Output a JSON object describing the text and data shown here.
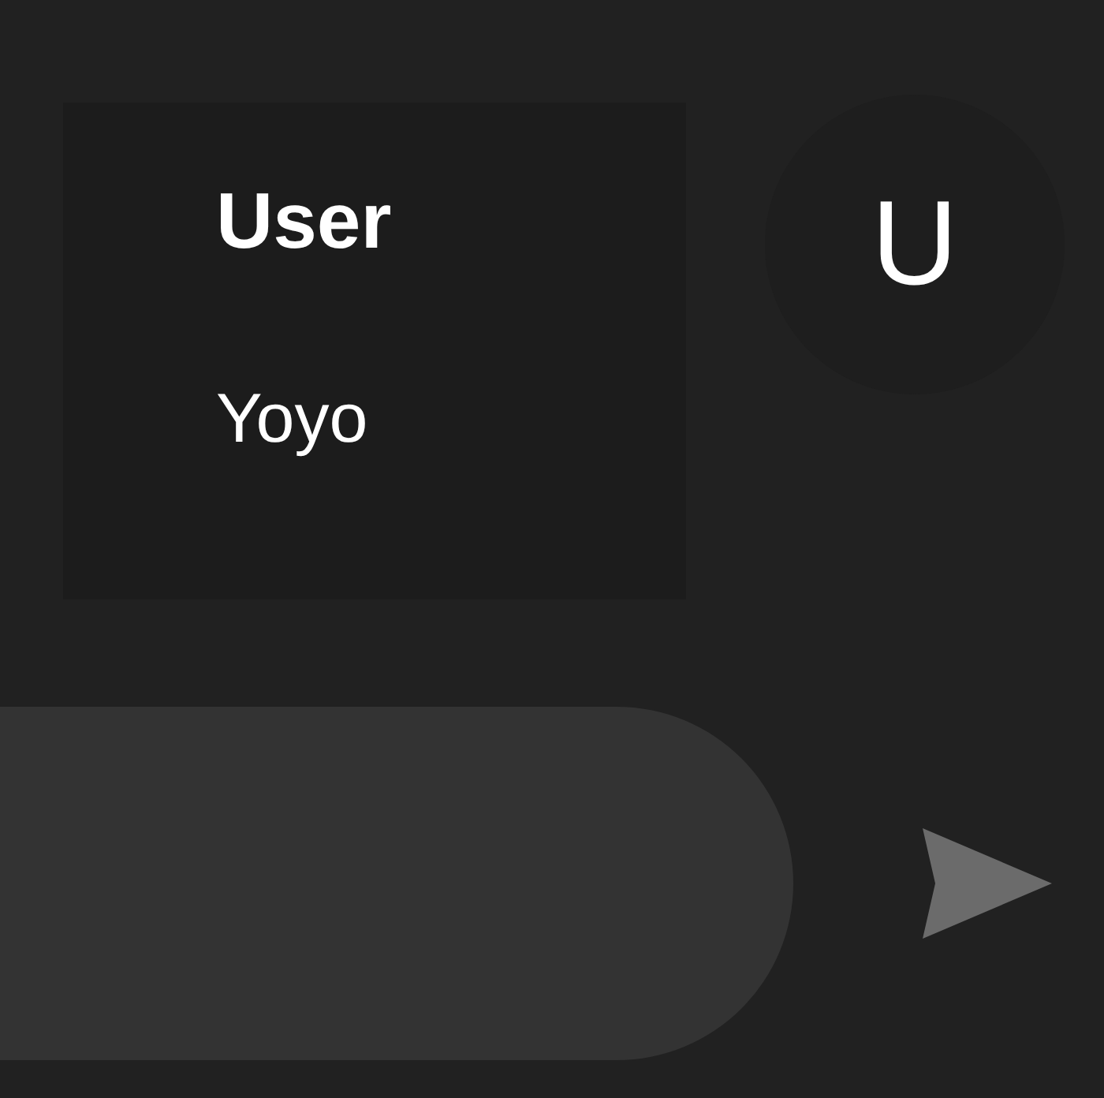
{
  "message": {
    "sender": "User",
    "text": "Yoyo"
  },
  "avatar": {
    "initial": "U"
  }
}
